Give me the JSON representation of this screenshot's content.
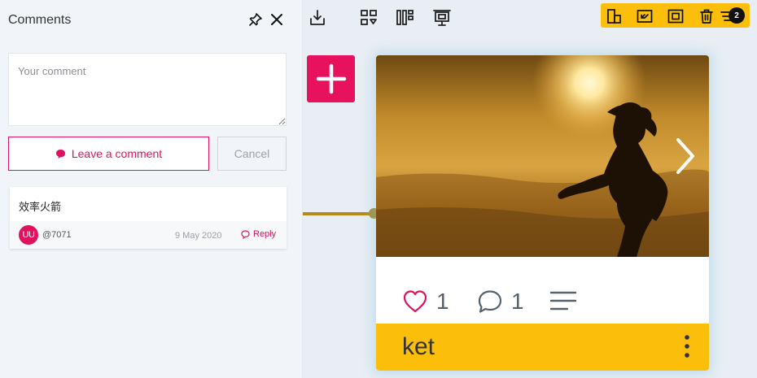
{
  "panel": {
    "title": "Comments",
    "comment_placeholder": "Your comment",
    "leave_label": "Leave a comment",
    "cancel_label": "Cancel",
    "comments": [
      {
        "text": "效率火箭",
        "avatar_initials": "UU",
        "username": "@7071",
        "date": "9 May 2020",
        "reply_label": "Reply"
      }
    ]
  },
  "toolbar": {
    "icons": [
      "download-icon",
      "grid-filter-icon",
      "columns-icon",
      "presentation-icon"
    ]
  },
  "selection_toolbar": {
    "icons": [
      "align-icon",
      "resize-icon",
      "frame-icon",
      "trash-icon",
      "layers-icon"
    ],
    "badge": "2"
  },
  "card": {
    "title": "ket",
    "likes": "1",
    "comments": "1"
  },
  "colors": {
    "accent": "#e0115f",
    "yellow": "#fbbf0b",
    "connector": "#b58a1c"
  }
}
